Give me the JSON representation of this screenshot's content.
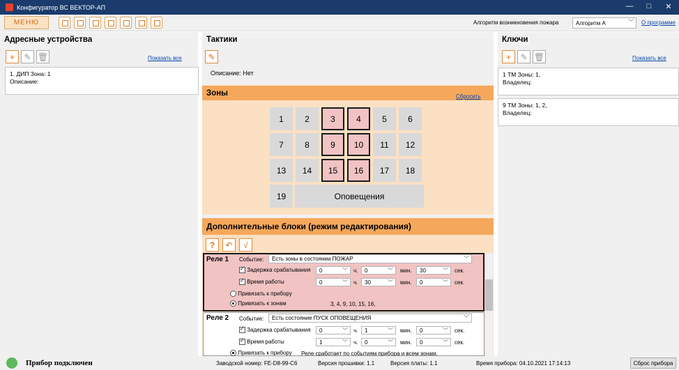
{
  "window": {
    "title": "Конфигуратор ВС ВЕКТОР-АП",
    "minimize": "—",
    "maximize": "□",
    "close": "✕"
  },
  "toolbar": {
    "menu_label": "МЕНЮ",
    "algo_label": "Алгоритм возникновения пожара",
    "algo_value": "Алгоритм А",
    "about_link": "О программе"
  },
  "left": {
    "title": "Адресные устройства",
    "show_all": "Показать все",
    "add": "+",
    "edit": "✎",
    "del": "🗑",
    "items": [
      {
        "line1": "1.  ДИП  Зона: 1",
        "line2": "Описание:"
      }
    ]
  },
  "tactics": {
    "title": "Тактики",
    "edit": "✎",
    "description": "Описание: Нет"
  },
  "zones": {
    "title": "Зоны",
    "reset": "Сбросить",
    "cells": [
      "1",
      "2",
      "3",
      "4",
      "5",
      "6",
      "7",
      "8",
      "9",
      "10",
      "11",
      "12",
      "13",
      "14",
      "15",
      "16",
      "17",
      "18",
      "19"
    ],
    "selected": [
      "3",
      "4",
      "9",
      "10",
      "15",
      "16"
    ],
    "alert": "Оповещения"
  },
  "extra": {
    "title": "Дополнительные блоки (режим редактирования)",
    "help": "?",
    "undo": "↶",
    "apply": "√"
  },
  "relays": [
    {
      "name": "Реле 1",
      "event_lbl": "Событие:",
      "event": "Есть зоны в состоянии ПОЖАР",
      "delay_lbl": "Задержка срабатывания",
      "delay_h": "0",
      "delay_m": "0",
      "delay_s": "30",
      "work_lbl": "Время работы",
      "work_h": "0",
      "work_m": "30",
      "work_s": "0",
      "h": "ч.",
      "m": "мин.",
      "s": "сек.",
      "bind_dev": "Привязать к прибору",
      "bind_zones": "Привязать к зонам",
      "zones_list": "3, 4, 9, 10, 15, 16,"
    },
    {
      "name": "Реле 2",
      "event_lbl": "Событие:",
      "event": "Есть состояние ПУСК ОПОВЕЩЕНИЯ",
      "delay_lbl": "Задержка срабатывания",
      "delay_h": "0",
      "delay_m": "1",
      "delay_s": "0",
      "work_lbl": "Время работы",
      "work_h": "1",
      "work_m": "0",
      "work_s": "0",
      "h": "ч.",
      "m": "мин.",
      "s": "сек.",
      "bind_dev": "Привязать к прибору",
      "bind_note": "Реле сработает по событиям прибора и всем зонам."
    }
  ],
  "keys": {
    "title": "Ключи",
    "show_all": "Показать все",
    "add": "+",
    "edit": "✎",
    "del": "🗑",
    "items": [
      {
        "line1": "1  ТМ Зоны: 1,",
        "line2": "Владелец:"
      },
      {
        "line1": "9  ТМ Зоны: 1, 2,",
        "line2": "Владелец:"
      }
    ]
  },
  "status": {
    "connected": "Прибор подключен",
    "serial": "Заводской номер: FE-D8-99-C6",
    "fw": "Версия прошивки: 1.1",
    "board": "Версия платы: 1.1",
    "time": "Время прибора: 04.10.2021 17:14:13",
    "reset": "Сброс прибора"
  },
  "colors": {
    "accent": "#f5a85c",
    "connected": "#5cb85c",
    "selected_zone": "#f1c3c3"
  }
}
